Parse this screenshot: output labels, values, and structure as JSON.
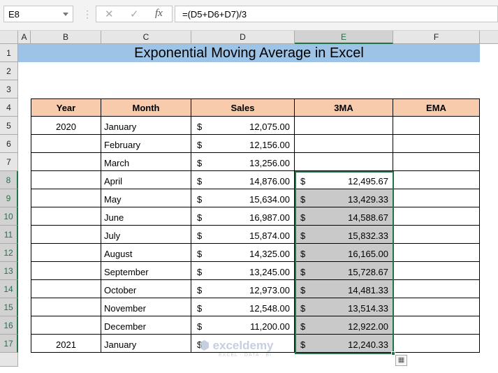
{
  "name_box": "E8",
  "formula": "=(D5+D6+D7)/3",
  "fx_icons": {
    "cancel": "✕",
    "enter": "✓",
    "fx": "fx"
  },
  "columns": [
    "A",
    "B",
    "C",
    "D",
    "E",
    "F"
  ],
  "rows": [
    "1",
    "2",
    "3",
    "4",
    "5",
    "6",
    "7",
    "8",
    "9",
    "10",
    "11",
    "12",
    "13",
    "14",
    "15",
    "16",
    "17"
  ],
  "selected": {
    "column": "E",
    "rows_from": 8,
    "rows_to": 17
  },
  "title": "Exponential Moving Average in Excel",
  "colors": {
    "title_fill": "#9dc3e6",
    "header_fill": "#f8cbad",
    "selection": "#217346",
    "shade": "#c9c9c9"
  },
  "table": {
    "headers": [
      "Year",
      "Month",
      "Sales",
      "3MA",
      "EMA"
    ],
    "currency": "$",
    "rows": [
      {
        "year": "2020",
        "month": "January",
        "sales": "12,075.00",
        "ma": "",
        "ema": ""
      },
      {
        "year": "",
        "month": "February",
        "sales": "12,156.00",
        "ma": "",
        "ema": ""
      },
      {
        "year": "",
        "month": "March",
        "sales": "13,256.00",
        "ma": "",
        "ema": ""
      },
      {
        "year": "",
        "month": "April",
        "sales": "14,876.00",
        "ma": "12,495.67",
        "ema": ""
      },
      {
        "year": "",
        "month": "May",
        "sales": "15,634.00",
        "ma": "13,429.33",
        "ema": ""
      },
      {
        "year": "",
        "month": "June",
        "sales": "16,987.00",
        "ma": "14,588.67",
        "ema": ""
      },
      {
        "year": "",
        "month": "July",
        "sales": "15,874.00",
        "ma": "15,832.33",
        "ema": ""
      },
      {
        "year": "",
        "month": "August",
        "sales": "14,325.00",
        "ma": "16,165.00",
        "ema": ""
      },
      {
        "year": "",
        "month": "September",
        "sales": "13,245.00",
        "ma": "15,728.67",
        "ema": ""
      },
      {
        "year": "",
        "month": "October",
        "sales": "12,973.00",
        "ma": "14,481.33",
        "ema": ""
      },
      {
        "year": "",
        "month": "November",
        "sales": "12,548.00",
        "ma": "13,514.33",
        "ema": ""
      },
      {
        "year": "",
        "month": "December",
        "sales": "11,200.00",
        "ma": "12,922.00",
        "ema": ""
      },
      {
        "year": "2021",
        "month": "January",
        "sales": "",
        "ma": "12,240.33",
        "ema": ""
      }
    ]
  },
  "watermark": {
    "name": "exceldemy",
    "tagline": "EXCEL · DATA · BI"
  }
}
